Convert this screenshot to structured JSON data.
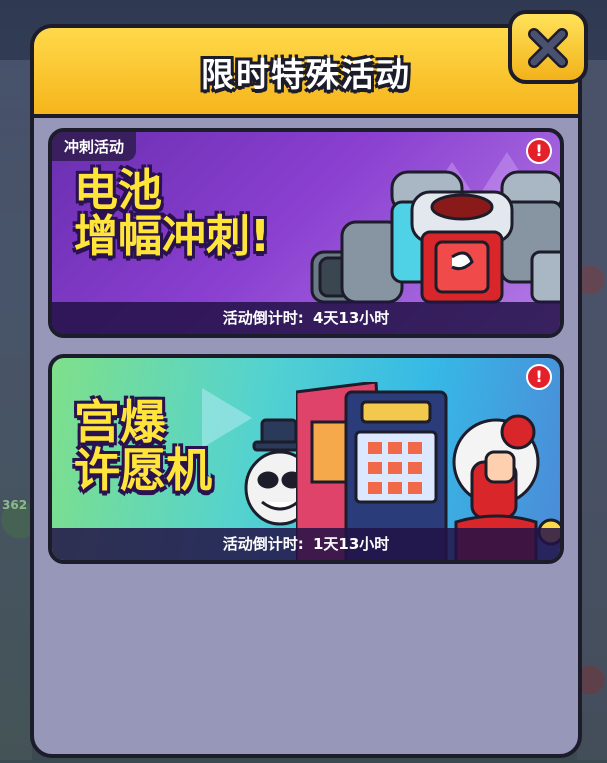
{
  "modal": {
    "title": "限时特殊活动"
  },
  "cards": [
    {
      "tag": "冲刺活动",
      "title_line1": "电池",
      "title_line2": "增幅冲刺!",
      "countdown_label": "活动倒计时:",
      "countdown_value": "4天13小时",
      "alert": "!"
    },
    {
      "tag": "",
      "title_line1": "宫爆",
      "title_line2": "许愿机",
      "countdown_label": "活动倒计时:",
      "countdown_value": "1天13小时",
      "alert": "!"
    }
  ],
  "background": {
    "side_number": "362"
  },
  "colors": {
    "header": "#f6b51c",
    "modal_body": "#9697b9",
    "card1": "#8a3fd0",
    "card2": "#36b9e6",
    "title_text": "#ffe53a",
    "alert": "#e4202a"
  }
}
